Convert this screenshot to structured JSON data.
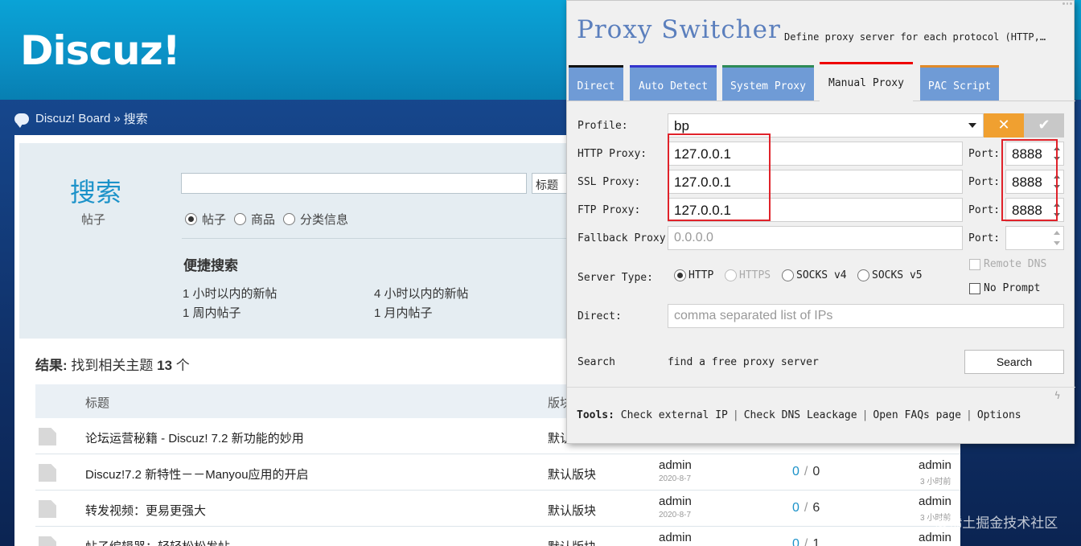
{
  "discuz": {
    "logo": "Discuz!",
    "breadcrumb": {
      "site": "Discuz! Board",
      "sep": "»",
      "page": "搜索"
    },
    "search": {
      "title": "搜索",
      "subtitle": "帖子",
      "type_select": "标题",
      "radios": [
        "帖子",
        "商品",
        "分类信息"
      ],
      "quick_title": "便捷搜索",
      "quick_links": [
        "1 小时以内的新帖",
        "4 小时以内的新帖",
        "1 周内帖子",
        "1 月内帖子"
      ]
    },
    "result": {
      "label": "结果:",
      "text": "找到相关主题",
      "count": "13",
      "unit": "个"
    },
    "table": {
      "headers": [
        "标题",
        "版块"
      ],
      "rows": [
        {
          "title": "论坛运营秘籍 - Discuz! 7.2 新功能的妙用",
          "forum": "默认",
          "author": "",
          "date": "",
          "replies": "",
          "views": "",
          "last": "",
          "last_time": ""
        },
        {
          "title": "Discuz!7.2 新特性－－Manyou应用的开启",
          "forum": "默认版块",
          "author": "admin",
          "date": "2020-8-7",
          "replies": "0",
          "views": "0",
          "last": "admin",
          "last_time": "3 小时前"
        },
        {
          "title": "转发视频：更易更强大",
          "forum": "默认版块",
          "author": "admin",
          "date": "2020-8-7",
          "replies": "0",
          "views": "6",
          "last": "admin",
          "last_time": "3 小时前"
        },
        {
          "title": "帖子编辑器：轻轻松松发帖",
          "forum": "默认版块",
          "author": "admin",
          "date": "",
          "replies": "0",
          "views": "1",
          "last": "admin",
          "last_time": ""
        }
      ]
    },
    "watermark": "@稀土掘金技术社区"
  },
  "proxy": {
    "title": "Proxy Switcher",
    "description": "Define proxy server for each protocol (HTTP,…",
    "tabs": [
      {
        "label": "Direct",
        "color": "#111111"
      },
      {
        "label": "Auto Detect",
        "color": "#3333cc"
      },
      {
        "label": "System Proxy",
        "color": "#2e8b57"
      },
      {
        "label": "Manual Proxy",
        "color": "#e00000"
      },
      {
        "label": "PAC Script",
        "color": "#e08a2a"
      }
    ],
    "active_tab": "Manual Proxy",
    "profile_label": "Profile:",
    "profile_value": "bp",
    "close_glyph": "✕",
    "ok_glyph": "✔",
    "rows": [
      {
        "label": "HTTP Proxy:",
        "value": "127.0.0.1",
        "port_label": "Port:",
        "port": "8888"
      },
      {
        "label": "SSL Proxy:",
        "value": "127.0.0.1",
        "port_label": "Port:",
        "port": "8888"
      },
      {
        "label": "FTP Proxy:",
        "value": "127.0.0.1",
        "port_label": "Port:",
        "port": "8888"
      },
      {
        "label": "Fallback Proxy:",
        "placeholder": "0.0.0.0",
        "port_label": "Port:",
        "port": ""
      }
    ],
    "server_type_label": "Server Type:",
    "server_types": [
      "HTTP",
      "HTTPS",
      "SOCKS v4",
      "SOCKS v5"
    ],
    "selected_server_type": "HTTP",
    "remote_dns": "Remote DNS",
    "no_prompt": "No Prompt",
    "direct_label": "Direct:",
    "direct_placeholder": "comma separated list of IPs",
    "search_label": "Search",
    "search_text": "find a free proxy server",
    "search_button": "Search",
    "tools_label": "Tools:",
    "tools": [
      "Check external IP",
      "Check DNS Leackage",
      "Open FAQs page",
      "Options"
    ],
    "corner_glyph": "ϟ"
  }
}
